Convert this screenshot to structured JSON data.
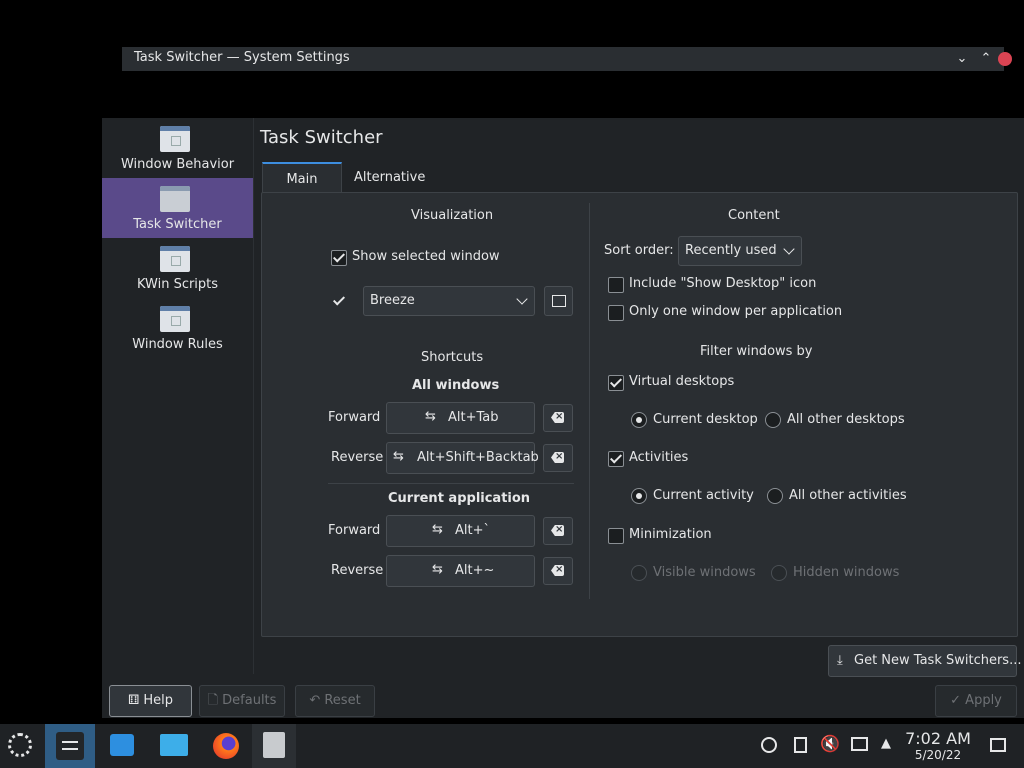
{
  "window": {
    "title": "Task Switcher — System Settings"
  },
  "sidebar": {
    "items": [
      {
        "label": "Window Behavior"
      },
      {
        "label": "Task Switcher"
      },
      {
        "label": "KWin Scripts"
      },
      {
        "label": "Window Rules"
      }
    ]
  },
  "page": {
    "title": "Task Switcher"
  },
  "tabs": [
    {
      "label": "Main"
    },
    {
      "label": "Alternative"
    }
  ],
  "visualization": {
    "heading": "Visualization",
    "show_selected": "Show selected window",
    "theme_value": "Breeze"
  },
  "shortcuts": {
    "heading": "Shortcuts",
    "all_windows": "All windows",
    "current_app": "Current application",
    "forward_label": "Forward",
    "reverse_label": "Reverse",
    "all_forward": "Alt+Tab",
    "all_reverse": "Alt+Shift+Backtab",
    "app_forward": "Alt+`",
    "app_reverse": "Alt+~"
  },
  "content": {
    "heading": "Content",
    "sort_label": "Sort order:",
    "sort_value": "Recently used",
    "include_desktop": "Include \"Show Desktop\" icon",
    "one_window": "Only one window per application",
    "filter_heading": "Filter windows by",
    "virtual_desktops": "Virtual desktops",
    "current_desktop": "Current desktop",
    "all_other_desktops": "All other desktops",
    "activities": "Activities",
    "current_activity": "Current activity",
    "all_other_activities": "All other activities",
    "minimization": "Minimization",
    "visible_windows": "Visible windows",
    "hidden_windows": "Hidden windows"
  },
  "footer": {
    "get_new": "Get New Task Switchers...",
    "help": "Help",
    "defaults": "Defaults",
    "reset": "Reset",
    "apply": "Apply"
  },
  "taskbar": {
    "time": "7:02 AM",
    "date": "5/20/22"
  },
  "colors": {
    "accent": "#3d8ee0",
    "selection": "#5a4a8a",
    "bg": "#202326",
    "panel": "#2a2e32"
  }
}
